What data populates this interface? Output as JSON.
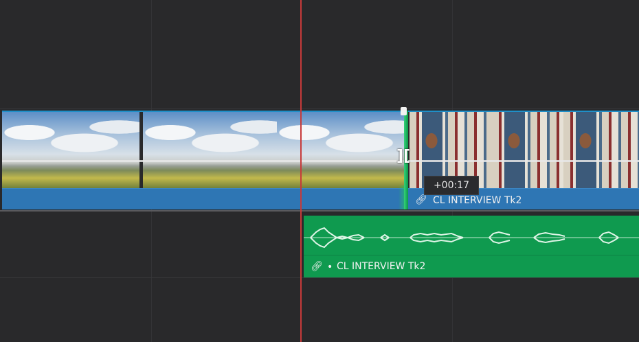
{
  "timeline": {
    "video_clip_b": {
      "name": "CL INTERVIEW Tk2",
      "link_icon": "link-icon"
    },
    "audio_clip": {
      "name": "CL INTERVIEW Tk2",
      "marker": "•",
      "link_icon": "link-icon"
    },
    "trim_tooltip": "+00:17",
    "trim_cursor_glyph": "][",
    "colors": {
      "background": "#29292b",
      "video_clip_bar": "#2e76b4",
      "audio_clip": "#0f9a4f",
      "playhead": "#c73a3a",
      "edit_point": "#23c160"
    }
  }
}
